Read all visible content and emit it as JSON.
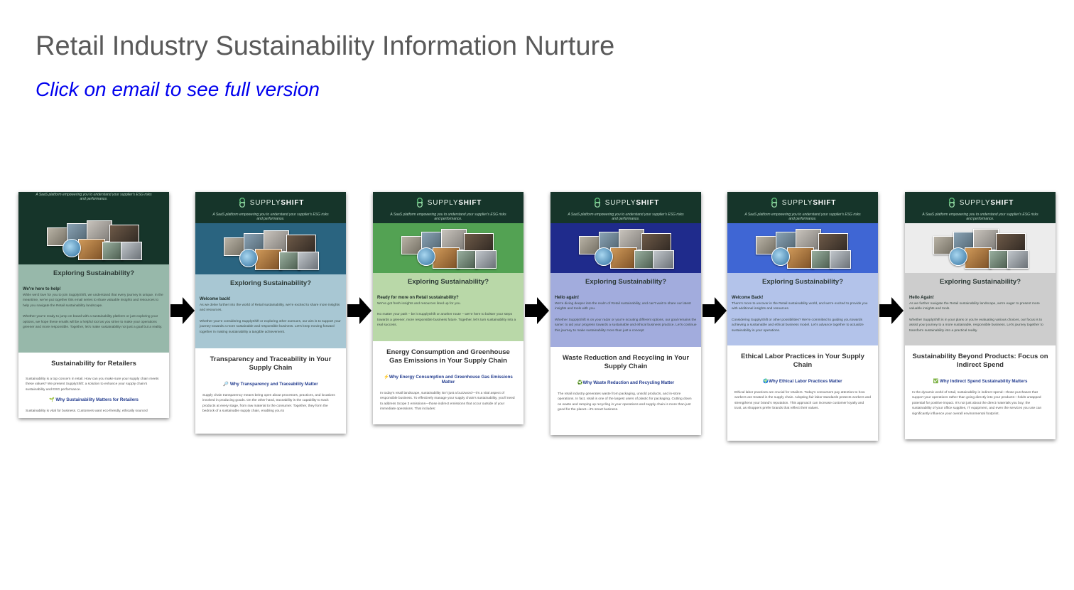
{
  "slide": {
    "title": "Retail Industry Sustainability Information Nurture",
    "subtitle": "Click on email to see full version"
  },
  "emails": [
    {
      "logo_light": "",
      "logo_bold": "",
      "tagline": "A SaaS platform empowering you to understand your supplier's ESG risks and performance.",
      "intro_title": "Exploring Sustainability?",
      "greeting": "We're here to help!",
      "intro_paragraphs": [
        "While we'd love for you to join SupplyShift, we understand that every journey is unique. In the meantime, we've put together this email series to share valuable insights and resources to help you navigate the Retail sustainability landscape.",
        "Whether you're ready to jump on board with a sustainability platform or just exploring your options, we hope these emails will be a helpful tool as you strive to make your operations greener and more responsible. Together, let's make sustainability not just a goal but a reality."
      ],
      "lower_heading": "Sustainability for Retailers",
      "lower_paragraph_1": "Sustainability is a top concern in retail. How can you make sure your supply chain meets these values? We present SupplyShift: a solution to enhance your supply chain's sustainability and ESG performance.",
      "why_heading": "🌱 Why Sustainability Matters for Retailers",
      "lower_paragraph_2": "Sustainability is vital for business. Customers want eco-friendly, ethically sourced"
    },
    {
      "logo_light": "SUPPLY",
      "logo_bold": "SHIFT",
      "tagline": "A SaaS platform empowering you to understand your supplier's ESG risks and performance.",
      "intro_title": "Exploring Sustainability?",
      "greeting": "Welcome back!",
      "intro_paragraphs": [
        "As we delve further into the world of Retail sustainability, we're excited to share more insights and resources.",
        "Whether you're considering SupplyShift or exploring other avenues, our aim is to support your journey towards a more sustainable and responsible business. Let's keep moving forward together in making sustainability a tangible achievement."
      ],
      "lower_heading": "Transparency and Traceability in Your Supply Chain",
      "lower_paragraph_1": "",
      "why_heading": "🔎 Why Transparency and Traceability Matter",
      "lower_paragraph_2": "Supply chain transparency means being open about processes, practices, and locations involved in producing goods. On the other hand, traceability is the capability to track products at every stage, from raw material to the consumer. Together, they form the bedrock of a sustainable supply chain, enabling you to"
    },
    {
      "logo_light": "SUPPLY",
      "logo_bold": "SHIFT",
      "tagline": "A SaaS platform empowering you to understand your supplier's ESG risks and performance.",
      "intro_title": "Exploring Sustainability?",
      "greeting": "Ready for more on Retail sustainability?",
      "intro_paragraphs": [
        "We've got fresh insights and resources lined up for you.",
        "No matter your path – be it SupplyShift or another route – we're here to bolster your steps towards a greener, more responsible business future. Together, let's turn sustainability into a real success."
      ],
      "lower_heading": "Energy Consumption and Greenhouse Gas Emissions in Your Supply Chain",
      "lower_paragraph_1": "",
      "why_heading": "⚡Why Energy Consumption and Greenhouse Gas Emissions Matter",
      "lower_paragraph_2": "In today's retail landscape, sustainability isn't just a buzzword—it's a vital aspect of responsible business. To effectively manage your supply chain's sustainability, you'll need to address Scope 3 emissions—those indirect emissions that occur outside of your immediate operations. That includes:"
    },
    {
      "logo_light": "SUPPLY",
      "logo_bold": "SHIFT",
      "tagline": "A SaaS platform empowering you to understand your supplier's ESG risks and performance.",
      "intro_title": "Exploring Sustainability?",
      "greeting": "Hello again!",
      "intro_paragraphs": [
        "We're diving deeper into the realm of Retail sustainability, and can't wait to share our latest insights and tools with you.",
        "Whether SupplyShift is on your radar or you're scouting different options, our goal remains the same: to aid your progress towards a sustainable and ethical business practice. Let's continue this journey to make sustainability more than just a concept"
      ],
      "lower_heading": "Waste Reduction and Recycling in Your Supply Chain",
      "lower_paragraph_1": "",
      "why_heading": "♻️Why Waste Reduction and Recycling Matter",
      "lower_paragraph_2": "The retail industry generates waste from packaging, unsold products, and in-store operations. In fact, retail is one of the largest users of plastic for packaging. Cutting down on waste and ramping up recycling in your operations and supply chain is more than just good for the planet—it's smart business."
    },
    {
      "logo_light": "SUPPLY",
      "logo_bold": "SHIFT",
      "tagline": "A SaaS platform empowering you to understand your supplier's ESG risks and performance.",
      "intro_title": "Exploring Sustainability?",
      "greeting": "Welcome Back!",
      "intro_paragraphs": [
        "There's more to uncover in the Retail sustainability world, and we're excited to provide you with additional insights and resources.",
        "Considering SupplyShift or other possibilities? We're committed to guiding you towards achieving a sustainable and ethical business model. Let's advance together to actualize sustainability in your operations."
      ],
      "lower_heading": "Ethical Labor Practices in Your Supply Chain",
      "lower_paragraph_1": "",
      "why_heading": "🌍Why Ethical Labor Practices Matter",
      "lower_paragraph_2": "Ethical labor practices are crucial for retailers. Today's consumers pay attention to how workers are treated in the supply chain. Adopting fair labor standards protects workers and strengthens your brand's reputation. This approach can increase customer loyalty and trust, as shoppers prefer brands that reflect their values."
    },
    {
      "logo_light": "SUPPLY",
      "logo_bold": "SHIFT",
      "tagline": "A SaaS platform empowering you to understand your supplier's ESG risks and performance.",
      "intro_title": "Exploring Sustainability?",
      "greeting": "Hello Again!",
      "intro_paragraphs": [
        "As we further navigate the Retail sustainability landscape, we're eager to present more valuable insights and tools.",
        "Whether SupplyShift is in your plans or you're evaluating various choices, our focus is to assist your journey to a more sustainable, responsible business. Let's journey together to transform sustainability into a practical reality."
      ],
      "lower_heading": "Sustainability Beyond Products: Focus on Indirect Spend",
      "lower_paragraph_1": "",
      "why_heading": "✅ Why Indirect Spend Sustainability Matters",
      "lower_paragraph_2": "In the dynamic world of retail, sustainability in indirect spend—those purchases that support your operations rather than going directly into your products—holds untapped potential for positive impact. It's not just about the direct materials you buy; the sustainability of your office supplies, IT equipment, and even the services you use can significantly influence your overall environmental footprint."
    }
  ],
  "colors": {
    "header": "#16352a",
    "banners": [
      "#16352a",
      "#2a6480",
      "#53a253",
      "#1f2b8c",
      "#3f66d4",
      "#ececec"
    ],
    "intros": [
      "#97b8aa",
      "#a8c7d3",
      "#b9d8a8",
      "#a2acdd",
      "#b3c3ea",
      "#cdcdcd"
    ],
    "arrow": "#000000",
    "heading_blue": "#243d8f"
  }
}
